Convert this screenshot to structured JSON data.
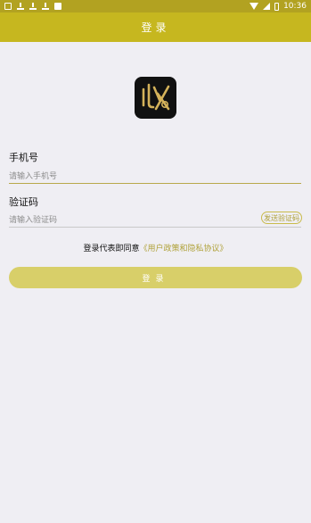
{
  "status_bar": {
    "time": "10:36",
    "icons": [
      "image-icon",
      "download-icon",
      "download-icon",
      "download-icon",
      "box-icon"
    ],
    "right_icons": [
      "wifi-icon",
      "signal-icon",
      "battery-icon"
    ]
  },
  "header": {
    "title": "登录"
  },
  "logo": {
    "icon": "app-logo-icon"
  },
  "phone": {
    "label": "手机号",
    "placeholder": "请输入手机号",
    "value": ""
  },
  "code": {
    "label": "验证码",
    "placeholder": "请输入验证码",
    "value": "",
    "send_label": "发送验证码"
  },
  "agreement": {
    "prefix": "登录代表即同意",
    "policy": "《用户政策和隐私协议》"
  },
  "login_button": {
    "label": "登录"
  },
  "colors": {
    "status_bar": "#b2a221",
    "header": "#c6b71f",
    "accent": "#b0a23a",
    "button": "#d8cf69",
    "background": "#efeef3"
  }
}
